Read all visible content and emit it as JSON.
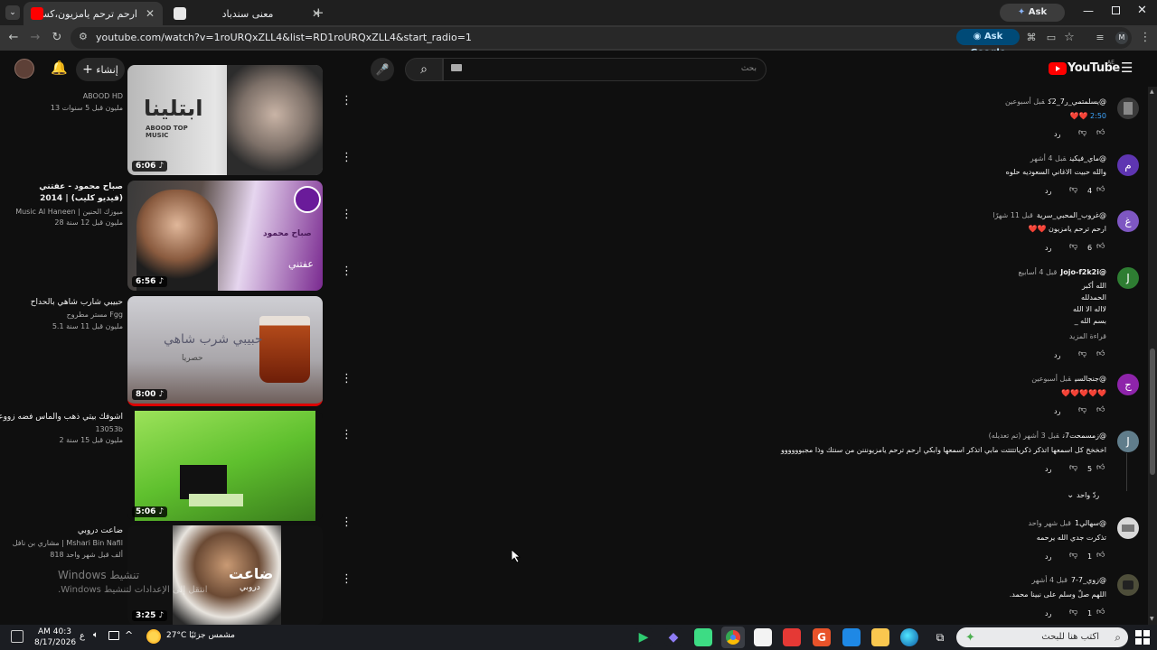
{
  "browser": {
    "tabs": [
      {
        "title": "ارحم ترحم يامزيون،كسرات - Tube",
        "active": true
      },
      {
        "title": "معنى سندباد",
        "active": false
      }
    ],
    "ask_gemini": "Ask Gemini",
    "url": "youtube.com/watch?v=1roURQxZLL4&list=RD1roURQxZLL4&start_radio=1",
    "ask_google": "Ask Google",
    "profile": "M"
  },
  "youtube": {
    "logo": "YouTube",
    "country": "AE",
    "search_placeholder": "بحث",
    "create_label": "إنشاء"
  },
  "videos": [
    {
      "title": "",
      "channel": "ABOOD HD",
      "meta": "13 مليون  قبل 5 سنوات",
      "duration": "6:06",
      "thumb_text": "ابتلينا",
      "thumb_sub": "ABOOD TOP MUSIC"
    },
    {
      "title": "صباح محمود - عفتني (فيديو كليب) | 2014",
      "channel": "Music Al Haneen | ميوزك الحنين",
      "meta": "28 مليون  قبل 12 سنة",
      "duration": "6:56",
      "thumb_text": "صباح محمود",
      "thumb_sub": "عفتني"
    },
    {
      "title": "حبيبي شارب شاهي بالحداح",
      "channel": "مستر مطروح Fgg",
      "meta": "5.1 مليون  قبل 11 سنة",
      "duration": "8:00",
      "thumb_text": "حبيبي شرب شاهي",
      "thumb_sub": "حصريا"
    },
    {
      "title": "اشوفك بيتي ذهب والماس فضه   زووعه",
      "channel": "13053b",
      "meta": "2 مليون  قبل 15 سنة",
      "duration": "5:06",
      "thumb_text": "",
      "thumb_sub": ""
    },
    {
      "title": "ضاعت دروبي",
      "channel": "مشاري بن نافل | Mshari Bin Nafil",
      "meta": "818 ألف  قبل شهر واحد",
      "duration": "3:25",
      "thumb_text": "ضاعت",
      "thumb_sub": "دروبي"
    }
  ],
  "comments": [
    {
      "handle": "@يسلمتمي_ر7_2ك",
      "time": "قبل أسبوعين",
      "text": [
        "2:50 ❤️❤️"
      ],
      "likes": "",
      "avatar_color": "#3a3a3a",
      "avatar_letter": ""
    },
    {
      "handle": "@ماي_فيكين",
      "time": "قبل 4 أشهر",
      "text": [
        "والله حبيت الاغاني السعوديه حلوه"
      ],
      "likes": "4",
      "avatar_color": "#5e35b1",
      "avatar_letter": "م"
    },
    {
      "handle": "@غروب_المحبي_سرية",
      "time": "قبل 11 شهرًا",
      "text": [
        "ارحم ترحم يامزيون ❤️❤️"
      ],
      "likes": "6",
      "avatar_color": "#7e57c2",
      "avatar_letter": "غ"
    },
    {
      "handle": "@Jojo-f2k2i",
      "time": "قبل 4 أسابيع",
      "text": [
        "الله أكبر",
        "الحمدلله",
        "لااله الا الله",
        "بسم الله _"
      ],
      "more": "قراءة المزيد",
      "likes": "",
      "avatar_color": "#2e7d32",
      "avatar_letter": "J"
    },
    {
      "handle": "@جنجالسي",
      "time": "قبل أسبوعين",
      "text": [
        "❤️❤️❤️❤️❤️"
      ],
      "likes": "",
      "avatar_color": "#8e24aa",
      "avatar_letter": "ج"
    },
    {
      "handle": "@زمسمحت7ن",
      "time": "قبل 3 أشهر (تم تعديله)",
      "text": [
        "اخخخخ كل اسمعها اتذكر ذكرياتتتتت مابي اتذكر اسمعها وابكي ارحم ترحم يامزيونننن من سنتك وذا مجبوووووو"
      ],
      "likes": "5",
      "avatar_color": "#607d8b",
      "avatar_letter": "J",
      "replies": "ردّ واحد"
    },
    {
      "handle": "@سهالي1",
      "time": "قبل شهر واحد",
      "text": [
        "تذكرت جدي الله يرحمه"
      ],
      "likes": "1",
      "avatar_color": "#d9d9d9",
      "avatar_letter": ""
    },
    {
      "handle": "@زوي_7-7",
      "time": "قبل 4 أشهر",
      "text": [
        "اللهم صلّ وسلم على نبينا محمد."
      ],
      "likes": "1",
      "avatar_color": "#4e4e3a",
      "avatar_letter": ""
    }
  ],
  "actions": {
    "reply": "رد"
  },
  "watermark": {
    "line1": "Windows تنشيط",
    "line2": "انتقل إلى الإعدادات لتنشيط Windows."
  },
  "taskbar": {
    "time": "AM 40:3",
    "date": "8/17/2026",
    "weather": "27°C  مشمس جزئيًا",
    "search_placeholder": "اكتب هنا للبحث",
    "lang": "ع"
  }
}
